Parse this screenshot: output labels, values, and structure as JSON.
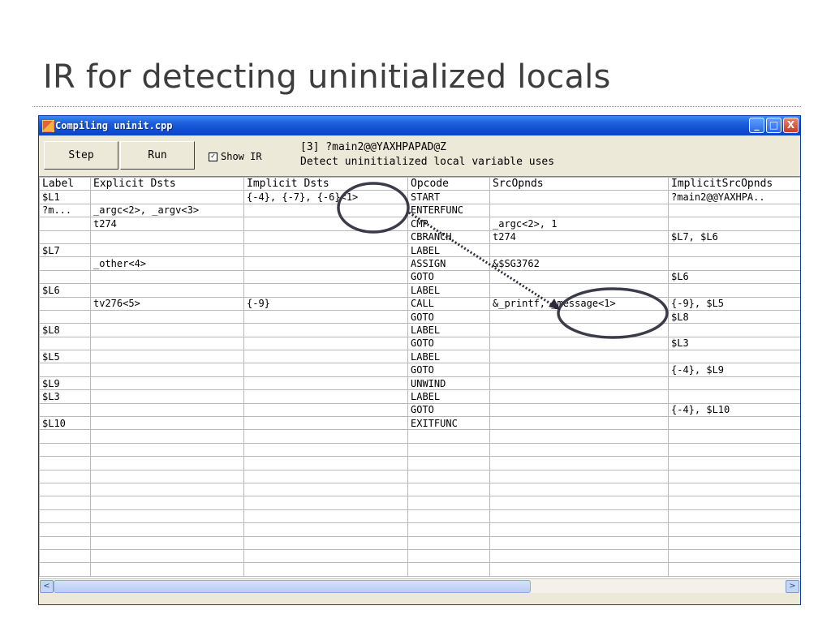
{
  "slide": {
    "title": "IR for detecting uninitialized locals"
  },
  "window": {
    "title": "Compiling uninit.cpp",
    "controls": {
      "minimize": "_",
      "maximize": "□",
      "close": "X"
    }
  },
  "toolbar": {
    "step_label": "Step",
    "run_label": "Run",
    "show_ir_label": "Show IR",
    "show_ir_checked": true,
    "info_line1": "[3] ?main2@@YAXHPAPAD@Z",
    "info_line2": "Detect uninitialized local variable uses"
  },
  "grid": {
    "columns": [
      "Label",
      "Explicit Dsts",
      "Implicit Dsts",
      "Opcode",
      "SrcOpnds",
      "ImplicitSrcOpnds"
    ],
    "rows": [
      [
        "$L1",
        "",
        "{-4}, {-7}, {-6}<1>",
        "START",
        "",
        "?main2@@YAXHPA.."
      ],
      [
        "?m...",
        "_argc<2>, _argv<3>",
        "",
        "ENTERFUNC",
        "",
        ""
      ],
      [
        "",
        "t274",
        "",
        "CMP",
        "_argc<2>, 1",
        ""
      ],
      [
        "",
        "",
        "",
        "CBRANCH",
        "t274",
        "$L7, $L6"
      ],
      [
        "$L7",
        "",
        "",
        "LABEL",
        "",
        ""
      ],
      [
        "",
        "_other<4>",
        "",
        "ASSIGN",
        "&$SG3762",
        ""
      ],
      [
        "",
        "",
        "",
        "GOTO",
        "",
        "$L6"
      ],
      [
        "$L6",
        "",
        "",
        "LABEL",
        "",
        ""
      ],
      [
        "",
        "tv276<5>",
        "{-9}",
        "CALL",
        "&_printf, _message<1>",
        "{-9}, $L5"
      ],
      [
        "",
        "",
        "",
        "GOTO",
        "",
        "$L8"
      ],
      [
        "$L8",
        "",
        "",
        "LABEL",
        "",
        ""
      ],
      [
        "",
        "",
        "",
        "GOTO",
        "",
        "$L3"
      ],
      [
        "$L5",
        "",
        "",
        "LABEL",
        "",
        ""
      ],
      [
        "",
        "",
        "",
        "GOTO",
        "",
        "{-4}, $L9"
      ],
      [
        "$L9",
        "",
        "",
        "UNWIND",
        "",
        ""
      ],
      [
        "$L3",
        "",
        "",
        "LABEL",
        "",
        ""
      ],
      [
        "",
        "",
        "",
        "GOTO",
        "",
        "{-4}, $L10"
      ],
      [
        "$L10",
        "",
        "",
        "EXITFUNC",
        "",
        ""
      ]
    ],
    "empty_row_count": 11
  },
  "scrollbar": {
    "left_arrow": "<",
    "right_arrow": ">"
  }
}
